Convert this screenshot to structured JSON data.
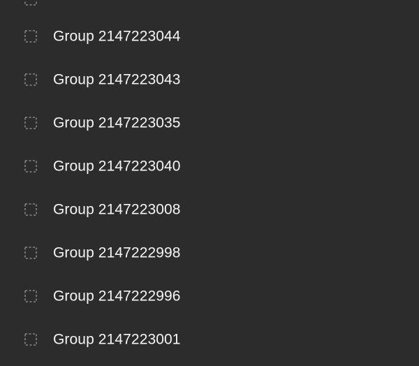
{
  "layers_panel": {
    "partial_top_row": {
      "icon": "dashed-frame-icon"
    },
    "layers": [
      {
        "label": "Group 2147223044",
        "icon": "dashed-frame-icon"
      },
      {
        "label": "Group 2147223043",
        "icon": "dashed-frame-icon"
      },
      {
        "label": "Group 2147223035",
        "icon": "dashed-frame-icon"
      },
      {
        "label": "Group 2147223040",
        "icon": "dashed-frame-icon"
      },
      {
        "label": "Group 2147223008",
        "icon": "dashed-frame-icon"
      },
      {
        "label": "Group 2147222998",
        "icon": "dashed-frame-icon"
      },
      {
        "label": "Group 2147222996",
        "icon": "dashed-frame-icon"
      },
      {
        "label": "Group 2147223001",
        "icon": "dashed-frame-icon"
      }
    ],
    "colors": {
      "background": "#2c2c2c",
      "text": "#f5f5f5",
      "icon": "#9a9a9a"
    }
  }
}
